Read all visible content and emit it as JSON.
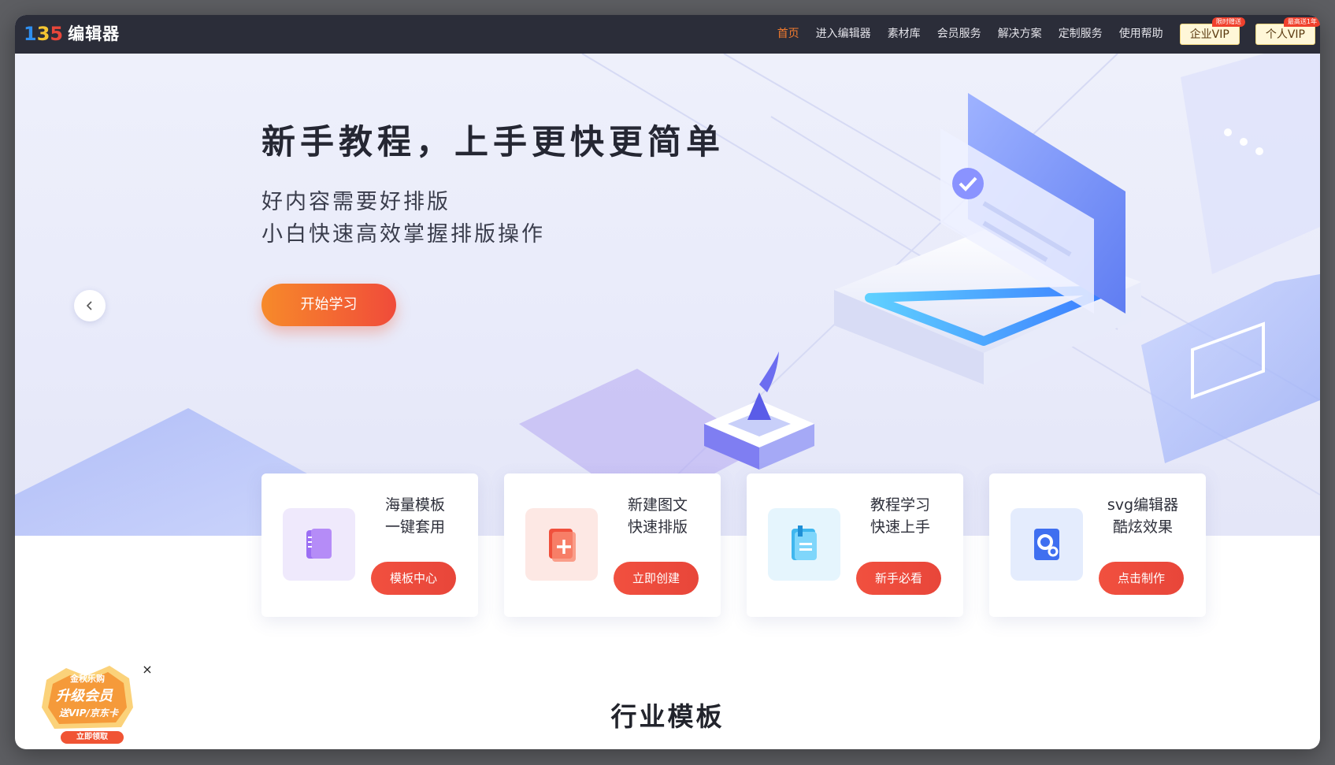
{
  "app": {
    "logo_mark": [
      "1",
      "3",
      "5"
    ],
    "logo_text": "编辑器"
  },
  "nav": {
    "links": [
      {
        "label": "首页",
        "active": true
      },
      {
        "label": "进入编辑器"
      },
      {
        "label": "素材库"
      },
      {
        "label": "会员服务"
      },
      {
        "label": "解决方案"
      },
      {
        "label": "定制服务"
      },
      {
        "label": "使用帮助"
      }
    ],
    "enterprise_vip": {
      "label": "企业VIP",
      "tag": "限时赠送"
    },
    "personal_vip": {
      "label": "个人VIP",
      "tag": "最高送1年"
    }
  },
  "hero": {
    "title": "新手教程，上手更快更简单",
    "subtitle_line1": "好内容需要好排版",
    "subtitle_line2": "小白快速高效掌握排版操作",
    "cta_label": "开始学习"
  },
  "cards": [
    {
      "line1": "海量模板",
      "line2": "一键套用",
      "button": "模板中心",
      "icon": "template-book-icon"
    },
    {
      "line1": "新建图文",
      "line2": "快速排版",
      "button": "立即创建",
      "icon": "new-document-icon"
    },
    {
      "line1": "教程学习",
      "line2": "快速上手",
      "button": "新手必看",
      "icon": "tutorial-notebook-icon"
    },
    {
      "line1": "svg编辑器",
      "line2": "酷炫效果",
      "button": "点击制作",
      "icon": "svg-settings-icon"
    }
  ],
  "section": {
    "title": "行业模板"
  },
  "promo": {
    "line1": "金秋乐购",
    "line2": "升级会员",
    "line3": "送VIP/京东卡",
    "button": "立即领取",
    "close": "×"
  },
  "colors": {
    "nav_bg": "#2b2d39",
    "accent_orange": "#f07a2e",
    "accent_red": "#f04b3a",
    "hero_bg": "#eef0fb"
  }
}
